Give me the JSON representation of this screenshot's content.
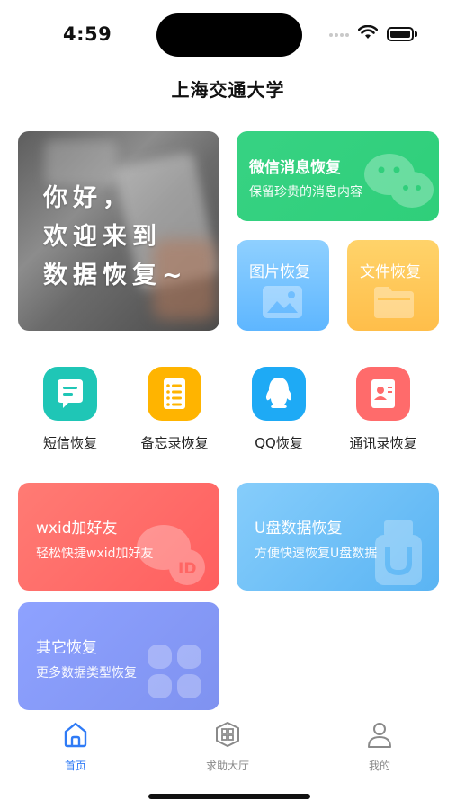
{
  "status_bar": {
    "time": "4:59"
  },
  "app_title": "上海交通大学",
  "hero": {
    "lines": [
      "你好，",
      "欢迎来到",
      "数据恢复~"
    ]
  },
  "cards": {
    "wechat": {
      "title": "微信消息恢复",
      "subtitle": "保留珍贵的消息内容",
      "color": "#34d17f"
    },
    "image": {
      "title": "图片恢复",
      "color": "#6fc0ff"
    },
    "file": {
      "title": "文件恢复",
      "color": "#ffc655"
    },
    "wxid": {
      "title": "wxid加好友",
      "subtitle": "轻松快捷wxid加好友",
      "color": "#ff6b68"
    },
    "udisk": {
      "title": "U盘数据恢复",
      "subtitle": "方便快速恢复U盘数据",
      "color": "#6fc0f8"
    },
    "other": {
      "title": "其它恢复",
      "subtitle": "更多数据类型恢复",
      "color": "#8798f5"
    }
  },
  "features": [
    {
      "label": "短信恢复",
      "icon": "message-icon",
      "color": "#1fc6b6"
    },
    {
      "label": "备忘录恢复",
      "icon": "memo-icon",
      "color": "#ffb400"
    },
    {
      "label": "QQ恢复",
      "icon": "qq-icon",
      "color": "#1eaaf5"
    },
    {
      "label": "通讯录恢复",
      "icon": "contacts-icon",
      "color": "#ff6b6b"
    }
  ],
  "tabbar": {
    "items": [
      {
        "label": "首页",
        "icon": "home-icon",
        "active": true
      },
      {
        "label": "求助大厅",
        "icon": "help-hall-icon",
        "active": false
      },
      {
        "label": "我的",
        "icon": "profile-icon",
        "active": false
      }
    ],
    "active_color": "#2f7bf6"
  }
}
